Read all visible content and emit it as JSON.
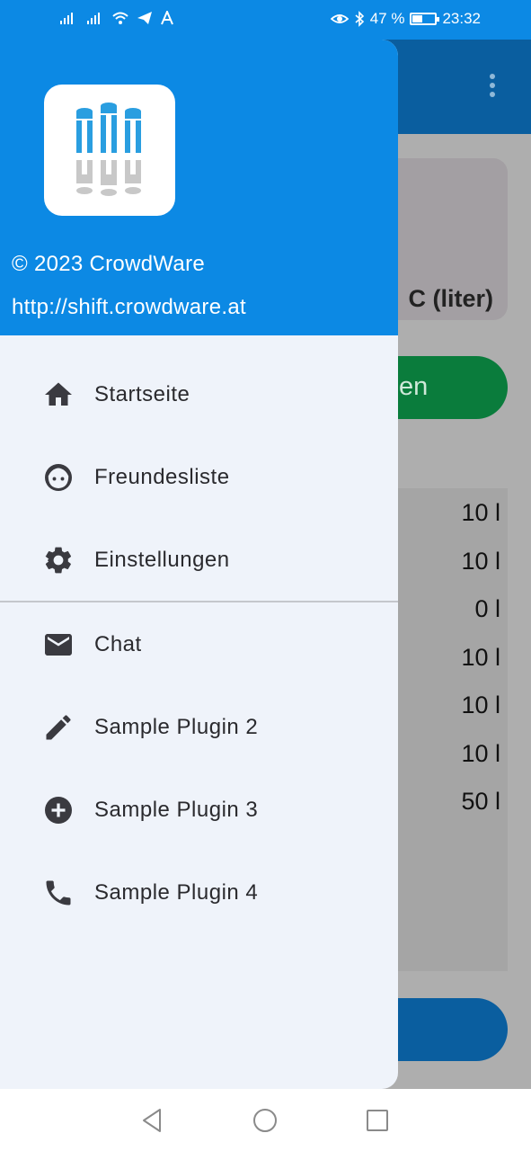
{
  "status_bar": {
    "battery_percent": "47 %",
    "battery_level": 0.47,
    "time": "23:32",
    "left_icons": [
      "signal-icon",
      "signal-icon",
      "wifi-icon",
      "telegram-icon",
      "font-icon"
    ],
    "right_icons": [
      "eye-icon",
      "bluetooth-icon",
      "battery-icon"
    ]
  },
  "background_app": {
    "card_title": "C (liter)",
    "button_label": "en",
    "values": [
      "10 l",
      "10 l",
      "0 l",
      "10 l",
      "10 l",
      "10 l",
      "50 l"
    ]
  },
  "drawer": {
    "header": {
      "copyright": "© 2023 CrowdWare",
      "url": "http://shift.crowdware.at"
    },
    "main_items": [
      {
        "label": "Startseite",
        "icon": "home-icon"
      },
      {
        "label": "Freundesliste",
        "icon": "face-icon"
      },
      {
        "label": "Einstellungen",
        "icon": "gear-icon"
      }
    ],
    "plugin_items": [
      {
        "label": "Chat",
        "icon": "mail-icon"
      },
      {
        "label": "Sample Plugin 2",
        "icon": "pencil-icon"
      },
      {
        "label": "Sample Plugin 3",
        "icon": "add-circle-icon"
      },
      {
        "label": "Sample Plugin 4",
        "icon": "phone-icon"
      }
    ]
  },
  "colors": {
    "primary": "#0c89e4",
    "dark_primary": "#0a5e9f",
    "drawer_background": "#eff3fa",
    "green": "#0a7c3c"
  }
}
